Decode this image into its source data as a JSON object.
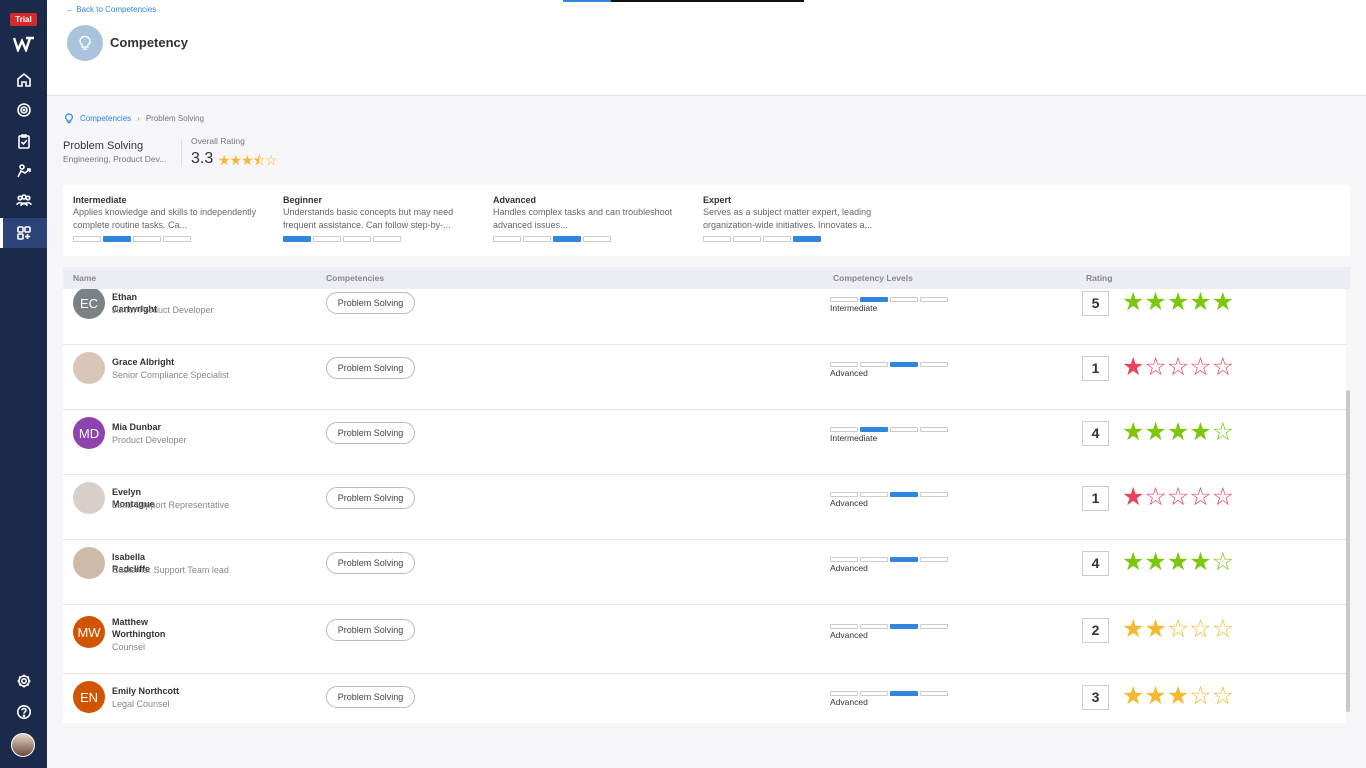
{
  "sidebar": {
    "trial_label": "Trial",
    "icons": [
      "home-icon",
      "goals-icon",
      "tasks-icon",
      "skills-icon",
      "team-icon",
      "apps-icon"
    ],
    "bottom_icons": [
      "settings-icon",
      "help-icon"
    ]
  },
  "header": {
    "back_link": "Back to Competencies",
    "title": "Competency"
  },
  "breadcrumb": {
    "root": "Competencies",
    "current": "Problem Solving"
  },
  "summary": {
    "name": "Problem Solving",
    "subtitle": "Engineering, Product Dev...",
    "overall_label": "Overall Rating",
    "overall_value": "3.3",
    "overall_stars": "★★★⯪☆"
  },
  "levels": [
    {
      "title": "Intermediate",
      "desc": "Applies knowledge and skills to independently complete routine tasks. Ca...",
      "level": 2
    },
    {
      "title": "Beginner",
      "desc": "Understands basic concepts but may need frequent assistance. Can follow step-by-...",
      "level": 1
    },
    {
      "title": "Advanced",
      "desc": "Handles complex tasks and can troubleshoot advanced issues...",
      "level": 3
    },
    {
      "title": "Expert",
      "desc": "Serves as a subject matter expert, leading organization-wide initiatives. Innovates a...",
      "level": 4
    }
  ],
  "table": {
    "headers": {
      "name": "Name",
      "competencies": "Competencies",
      "levels": "Competency Levels",
      "rating": "Rating"
    },
    "rows": [
      {
        "initials": "EC",
        "avatar_color": "#7b8287",
        "name": "Ethan Cartwright",
        "role": "Junior Product Developer",
        "competency": "Problem Solving",
        "level_label": "Intermediate",
        "level": 2,
        "rating": "5",
        "stars": "★★★★★",
        "star_color": "#7ac70c"
      },
      {
        "initials": "",
        "avatar_color": "#d9c6b8",
        "name": "Grace Albright",
        "role": "Senior Compliance Specialist",
        "competency": "Problem Solving",
        "level_label": "Advanced",
        "level": 3,
        "rating": "1",
        "stars": "★☆☆☆☆",
        "star_color": "#e8425f"
      },
      {
        "initials": "MD",
        "avatar_color": "#8e44ad",
        "name": "Mia Dunbar",
        "role": "Product Developer",
        "competency": "Problem Solving",
        "level_label": "Intermediate",
        "level": 2,
        "rating": "4",
        "stars": "★★★★☆",
        "star_color": "#7ac70c"
      },
      {
        "initials": "",
        "avatar_color": "#d8cfc8",
        "name": "Evelyn Montague",
        "role": "Lead Support Representative",
        "competency": "Problem Solving",
        "level_label": "Advanced",
        "level": 3,
        "rating": "1",
        "stars": "★☆☆☆☆",
        "star_color": "#e8425f"
      },
      {
        "initials": "",
        "avatar_color": "#cdbba8",
        "name": "Isabella Radcliffe",
        "role": "Customer Support Team lead",
        "competency": "Problem Solving",
        "level_label": "Advanced",
        "level": 3,
        "rating": "4",
        "stars": "★★★★☆",
        "star_color": "#7ac70c"
      },
      {
        "initials": "MW",
        "avatar_color": "#d35400",
        "name": "Matthew Worthington",
        "role": "Counsel",
        "competency": "Problem Solving",
        "level_label": "Advanced",
        "level": 3,
        "rating": "2",
        "stars": "★★☆☆☆",
        "star_color": "#f5b82e"
      },
      {
        "initials": "EN",
        "avatar_color": "#d35400",
        "name": "Emily Northcott",
        "role": "Legal Counsel",
        "competency": "Problem Solving",
        "level_label": "Advanced",
        "level": 3,
        "rating": "3",
        "stars": "★★★☆☆",
        "star_color": "#f5b82e"
      }
    ]
  }
}
